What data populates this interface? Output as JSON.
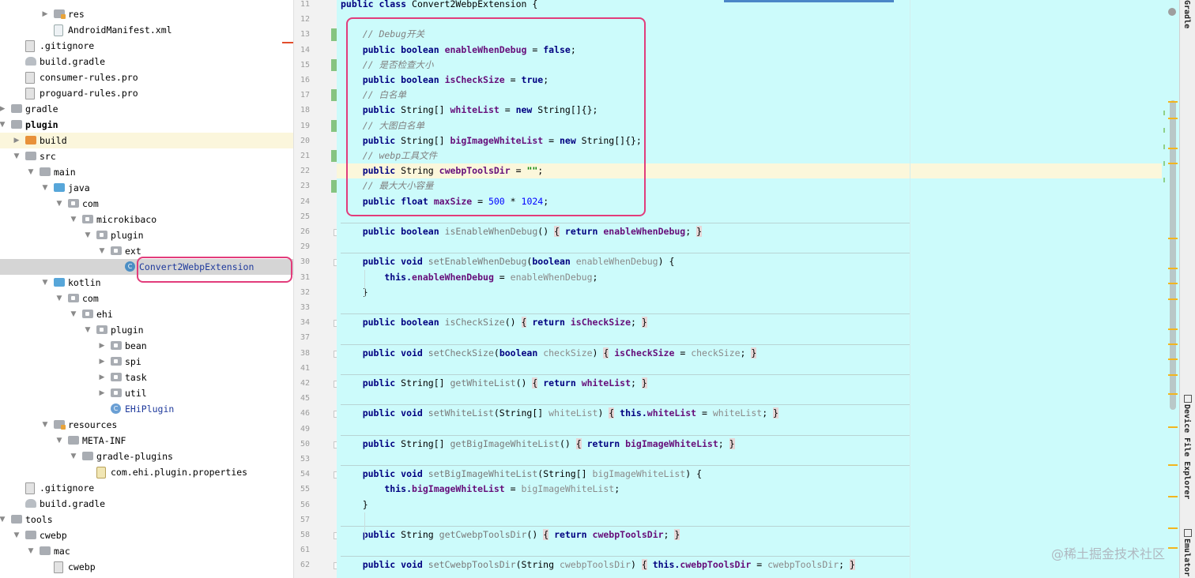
{
  "project_tree": [
    {
      "label": "res",
      "depth": 4,
      "arrow": "▶",
      "icon": "res-folder-icon"
    },
    {
      "label": "AndroidManifest.xml",
      "depth": 4,
      "arrow": "",
      "icon": "manifest-file-icon"
    },
    {
      "label": ".gitignore",
      "depth": 2,
      "arrow": "",
      "icon": "file-icon"
    },
    {
      "label": "build.gradle",
      "depth": 2,
      "arrow": "",
      "icon": "gradle-icon"
    },
    {
      "label": "consumer-rules.pro",
      "depth": 2,
      "arrow": "",
      "icon": "file-icon"
    },
    {
      "label": "proguard-rules.pro",
      "depth": 2,
      "arrow": "",
      "icon": "file-icon"
    },
    {
      "label": "gradle",
      "depth": 1,
      "arrow": "▶",
      "icon": "folder-icon"
    },
    {
      "label": "plugin",
      "depth": 1,
      "arrow": "▼",
      "icon": "module-folder-icon",
      "bold": true
    },
    {
      "label": "build",
      "depth": 2,
      "arrow": "▶",
      "icon": "orange-folder-icon",
      "highlight": true
    },
    {
      "label": "src",
      "depth": 2,
      "arrow": "▼",
      "icon": "folder-icon"
    },
    {
      "label": "main",
      "depth": 3,
      "arrow": "▼",
      "icon": "folder-icon"
    },
    {
      "label": "java",
      "depth": 4,
      "arrow": "▼",
      "icon": "source-folder-icon"
    },
    {
      "label": "com",
      "depth": 5,
      "arrow": "▼",
      "icon": "package-icon"
    },
    {
      "label": "microkibaco",
      "depth": 6,
      "arrow": "▼",
      "icon": "package-icon"
    },
    {
      "label": "plugin",
      "depth": 7,
      "arrow": "▼",
      "icon": "package-icon"
    },
    {
      "label": "ext",
      "depth": 8,
      "arrow": "▼",
      "icon": "package-icon"
    },
    {
      "label": "Convert2WebpExtension",
      "depth": 9,
      "arrow": "",
      "icon": "java-class-icon",
      "selected": true
    },
    {
      "label": "kotlin",
      "depth": 4,
      "arrow": "▼",
      "icon": "source-folder-icon"
    },
    {
      "label": "com",
      "depth": 5,
      "arrow": "▼",
      "icon": "package-icon"
    },
    {
      "label": "ehi",
      "depth": 6,
      "arrow": "▼",
      "icon": "package-icon"
    },
    {
      "label": "plugin",
      "depth": 7,
      "arrow": "▼",
      "icon": "package-icon"
    },
    {
      "label": "bean",
      "depth": 8,
      "arrow": "▶",
      "icon": "package-icon"
    },
    {
      "label": "spi",
      "depth": 8,
      "arrow": "▶",
      "icon": "package-icon"
    },
    {
      "label": "task",
      "depth": 8,
      "arrow": "▶",
      "icon": "package-icon"
    },
    {
      "label": "util",
      "depth": 8,
      "arrow": "▶",
      "icon": "package-icon"
    },
    {
      "label": "EHiPlugin",
      "depth": 8,
      "arrow": "",
      "icon": "kotlin-class-icon"
    },
    {
      "label": "resources",
      "depth": 4,
      "arrow": "▼",
      "icon": "res-folder-icon"
    },
    {
      "label": "META-INF",
      "depth": 5,
      "arrow": "▼",
      "icon": "folder-icon"
    },
    {
      "label": "gradle-plugins",
      "depth": 6,
      "arrow": "▼",
      "icon": "folder-icon"
    },
    {
      "label": "com.ehi.plugin.properties",
      "depth": 7,
      "arrow": "",
      "icon": "properties-file-icon"
    },
    {
      "label": ".gitignore",
      "depth": 2,
      "arrow": "",
      "icon": "file-icon"
    },
    {
      "label": "build.gradle",
      "depth": 2,
      "arrow": "",
      "icon": "gradle-icon"
    },
    {
      "label": "tools",
      "depth": 1,
      "arrow": "▼",
      "icon": "folder-icon"
    },
    {
      "label": "cwebp",
      "depth": 2,
      "arrow": "▼",
      "icon": "folder-icon"
    },
    {
      "label": "mac",
      "depth": 3,
      "arrow": "▼",
      "icon": "folder-icon"
    },
    {
      "label": "cwebp",
      "depth": 4,
      "arrow": "",
      "icon": "executable-file-icon"
    }
  ],
  "editor_lines": [
    {
      "n": "11",
      "sep": false,
      "tokens": [
        [
          "kw",
          "public class "
        ],
        [
          "plain",
          "Convert2WebpExtension {"
        ]
      ]
    },
    {
      "n": "12",
      "tokens": []
    },
    {
      "n": "13",
      "tokens": [
        [
          "cm",
          "    // Debug开关"
        ]
      ]
    },
    {
      "n": "14",
      "tokens": [
        [
          "kw",
          "    public boolean "
        ],
        [
          "fld",
          "enableWhenDebug"
        ],
        [
          "plain",
          " = "
        ],
        [
          "kw",
          "false"
        ],
        [
          "plain",
          ";"
        ]
      ]
    },
    {
      "n": "15",
      "tokens": [
        [
          "cm",
          "    // 是否检查大小"
        ]
      ]
    },
    {
      "n": "16",
      "tokens": [
        [
          "kw",
          "    public boolean "
        ],
        [
          "fld",
          "isCheckSize"
        ],
        [
          "plain",
          " = "
        ],
        [
          "kw",
          "true"
        ],
        [
          "plain",
          ";"
        ]
      ]
    },
    {
      "n": "17",
      "tokens": [
        [
          "cm",
          "    // 白名单"
        ]
      ]
    },
    {
      "n": "18",
      "tokens": [
        [
          "kw",
          "    public "
        ],
        [
          "plain",
          "String[] "
        ],
        [
          "fld",
          "whiteList"
        ],
        [
          "plain",
          " = "
        ],
        [
          "kw",
          "new "
        ],
        [
          "plain",
          "String[]{};"
        ]
      ]
    },
    {
      "n": "19",
      "tokens": [
        [
          "cm",
          "    // 大图白名单"
        ]
      ]
    },
    {
      "n": "20",
      "tokens": [
        [
          "kw",
          "    public "
        ],
        [
          "plain",
          "String[] "
        ],
        [
          "fld",
          "bigImageWhiteList"
        ],
        [
          "plain",
          " = "
        ],
        [
          "kw",
          "new "
        ],
        [
          "plain",
          "String[]{};"
        ]
      ]
    },
    {
      "n": "21",
      "tokens": [
        [
          "cm",
          "    // webp工具文件"
        ]
      ]
    },
    {
      "n": "22",
      "caret": true,
      "tokens": [
        [
          "kw",
          "    public "
        ],
        [
          "plain",
          "String "
        ],
        [
          "fld",
          "cwebpToolsDir"
        ],
        [
          "plain",
          " = "
        ],
        [
          "str",
          "\"\""
        ],
        [
          "plain",
          ";"
        ]
      ]
    },
    {
      "n": "23",
      "tokens": [
        [
          "cm",
          "    // 最大大小容量"
        ]
      ]
    },
    {
      "n": "24",
      "tokens": [
        [
          "kw",
          "    public float "
        ],
        [
          "fld",
          "maxSize"
        ],
        [
          "plain",
          " = "
        ],
        [
          "num",
          "500"
        ],
        [
          "plain",
          " * "
        ],
        [
          "num",
          "1024"
        ],
        [
          "plain",
          ";"
        ]
      ]
    },
    {
      "n": "25",
      "tokens": []
    },
    {
      "n": "26",
      "sep": true,
      "tokens": [
        [
          "kw",
          "    public boolean "
        ],
        [
          "mth",
          "isEnableWhenDebug"
        ],
        [
          "plain",
          "() "
        ],
        [
          "brace",
          "{"
        ],
        [
          "kw",
          " return "
        ],
        [
          "fld",
          "enableWhenDebug"
        ],
        [
          "plain",
          "; "
        ],
        [
          "brace",
          "}"
        ]
      ]
    },
    {
      "n": "29",
      "tokens": []
    },
    {
      "n": "30",
      "sep": true,
      "tokens": [
        [
          "kw",
          "    public void "
        ],
        [
          "mth",
          "setEnableWhenDebug"
        ],
        [
          "plain",
          "("
        ],
        [
          "kw",
          "boolean "
        ],
        [
          "par",
          "enableWhenDebug"
        ],
        [
          "plain",
          ") {"
        ]
      ]
    },
    {
      "n": "31",
      "tokens": [
        [
          "kw",
          "        this."
        ],
        [
          "fld",
          "enableWhenDebug"
        ],
        [
          "plain",
          " = "
        ],
        [
          "par",
          "enableWhenDebug"
        ],
        [
          "plain",
          ";"
        ]
      ]
    },
    {
      "n": "32",
      "tokens": [
        [
          "plain",
          "    }"
        ]
      ]
    },
    {
      "n": "33",
      "tokens": []
    },
    {
      "n": "34",
      "sep": true,
      "tokens": [
        [
          "kw",
          "    public boolean "
        ],
        [
          "mth",
          "isCheckSize"
        ],
        [
          "plain",
          "() "
        ],
        [
          "brace",
          "{"
        ],
        [
          "kw",
          " return "
        ],
        [
          "fld",
          "isCheckSize"
        ],
        [
          "plain",
          "; "
        ],
        [
          "brace",
          "}"
        ]
      ]
    },
    {
      "n": "37",
      "tokens": []
    },
    {
      "n": "38",
      "sep": true,
      "tokens": [
        [
          "kw",
          "    public void "
        ],
        [
          "mth",
          "setCheckSize"
        ],
        [
          "plain",
          "("
        ],
        [
          "kw",
          "boolean "
        ],
        [
          "par",
          "checkSize"
        ],
        [
          "plain",
          ") "
        ],
        [
          "brace",
          "{"
        ],
        [
          "plain",
          " "
        ],
        [
          "fld",
          "isCheckSize"
        ],
        [
          "plain",
          " = "
        ],
        [
          "par",
          "checkSize"
        ],
        [
          "plain",
          "; "
        ],
        [
          "brace",
          "}"
        ]
      ]
    },
    {
      "n": "41",
      "tokens": []
    },
    {
      "n": "42",
      "sep": true,
      "tokens": [
        [
          "kw",
          "    public "
        ],
        [
          "plain",
          "String[] "
        ],
        [
          "mth",
          "getWhiteList"
        ],
        [
          "plain",
          "() "
        ],
        [
          "brace",
          "{"
        ],
        [
          "kw",
          " return "
        ],
        [
          "fld",
          "whiteList"
        ],
        [
          "plain",
          "; "
        ],
        [
          "brace",
          "}"
        ]
      ]
    },
    {
      "n": "45",
      "tokens": []
    },
    {
      "n": "46",
      "sep": true,
      "tokens": [
        [
          "kw",
          "    public void "
        ],
        [
          "mth",
          "setWhiteList"
        ],
        [
          "plain",
          "(String[] "
        ],
        [
          "par",
          "whiteList"
        ],
        [
          "plain",
          ") "
        ],
        [
          "brace",
          "{"
        ],
        [
          "kw",
          " this."
        ],
        [
          "fld",
          "whiteList"
        ],
        [
          "plain",
          " = "
        ],
        [
          "par",
          "whiteList"
        ],
        [
          "plain",
          "; "
        ],
        [
          "brace",
          "}"
        ]
      ]
    },
    {
      "n": "49",
      "tokens": []
    },
    {
      "n": "50",
      "sep": true,
      "tokens": [
        [
          "kw",
          "    public "
        ],
        [
          "plain",
          "String[] "
        ],
        [
          "mth",
          "getBigImageWhiteList"
        ],
        [
          "plain",
          "() "
        ],
        [
          "brace",
          "{"
        ],
        [
          "kw",
          " return "
        ],
        [
          "fld",
          "bigImageWhiteList"
        ],
        [
          "plain",
          "; "
        ],
        [
          "brace",
          "}"
        ]
      ]
    },
    {
      "n": "53",
      "tokens": []
    },
    {
      "n": "54",
      "sep": true,
      "tokens": [
        [
          "kw",
          "    public void "
        ],
        [
          "mth",
          "setBigImageWhiteList"
        ],
        [
          "plain",
          "(String[] "
        ],
        [
          "par",
          "bigImageWhiteList"
        ],
        [
          "plain",
          ") {"
        ]
      ]
    },
    {
      "n": "55",
      "tokens": [
        [
          "kw",
          "        this."
        ],
        [
          "fld",
          "bigImageWhiteList"
        ],
        [
          "plain",
          " = "
        ],
        [
          "par",
          "bigImageWhiteList"
        ],
        [
          "plain",
          ";"
        ]
      ]
    },
    {
      "n": "56",
      "tokens": [
        [
          "plain",
          "    }"
        ]
      ]
    },
    {
      "n": "57",
      "tokens": []
    },
    {
      "n": "58",
      "sep": true,
      "tokens": [
        [
          "kw",
          "    public "
        ],
        [
          "plain",
          "String "
        ],
        [
          "mth",
          "getCwebpToolsDir"
        ],
        [
          "plain",
          "() "
        ],
        [
          "brace",
          "{"
        ],
        [
          "kw",
          " return "
        ],
        [
          "fld",
          "cwebpToolsDir"
        ],
        [
          "plain",
          "; "
        ],
        [
          "brace",
          "}"
        ]
      ]
    },
    {
      "n": "61",
      "tokens": []
    },
    {
      "n": "62",
      "sep": true,
      "tokens": [
        [
          "kw",
          "    public void "
        ],
        [
          "mth",
          "setCwebpToolsDir"
        ],
        [
          "plain",
          "(String "
        ],
        [
          "par",
          "cwebpToolsDir"
        ],
        [
          "plain",
          ") "
        ],
        [
          "brace",
          "{"
        ],
        [
          "kw",
          " this."
        ],
        [
          "fld",
          "cwebpToolsDir"
        ],
        [
          "plain",
          " = "
        ],
        [
          "par",
          "cwebpToolsDir"
        ],
        [
          "plain",
          "; "
        ],
        [
          "brace",
          "}"
        ]
      ]
    }
  ],
  "tool_windows": {
    "gradle": "Gradle",
    "device_file_explorer": "Device File Explorer",
    "emulator": "Emulator"
  },
  "watermark": "@稀土掘金技术社区",
  "colors": {
    "editor_background": "#ccfbfb",
    "annotation_box": "#e23c7b",
    "keyword": "#000080",
    "field": "#660e7a",
    "comment": "#808080",
    "number": "#0000ff"
  }
}
